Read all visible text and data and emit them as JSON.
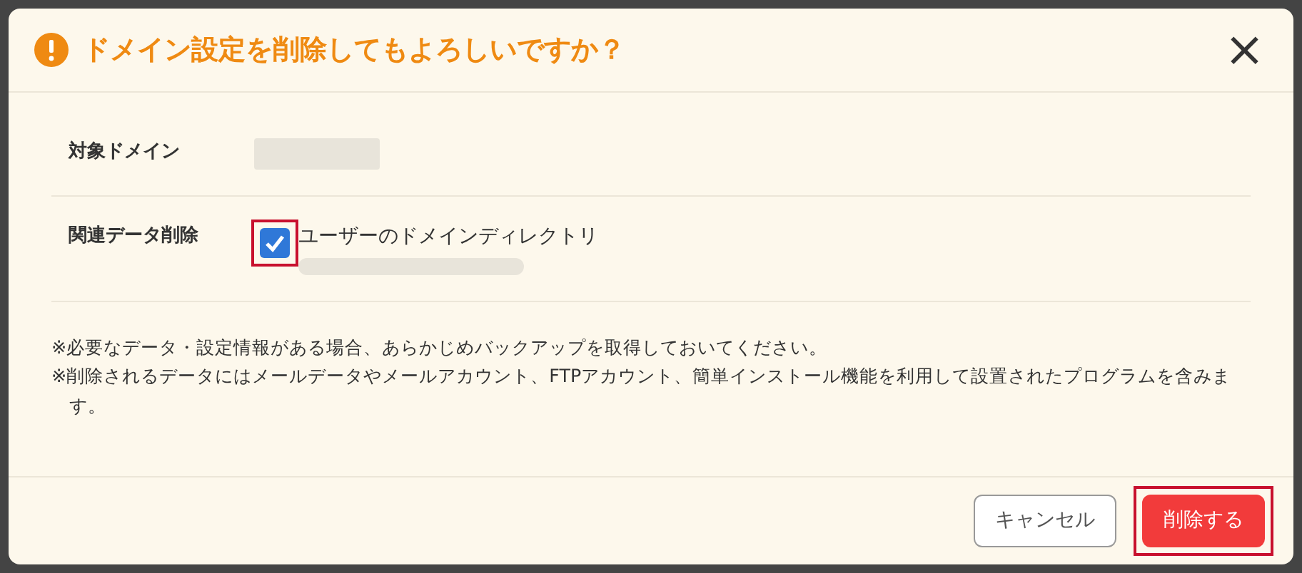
{
  "dialog": {
    "title": "ドメイン設定を削除してもよろしいですか？",
    "close": "×"
  },
  "fields": [
    {
      "kind": "redacted",
      "label": "対象ドメイン"
    },
    {
      "kind": "checkbox",
      "label": "関連データ削除",
      "option": "ユーザーのドメインディレクトリ",
      "checked": true,
      "highlighted": true
    }
  ],
  "notes": [
    "※必要なデータ・設定情報がある場合、あらかじめバックアップを取得しておいてください。",
    "※削除されるデータにはメールデータやメールアカウント、FTPアカウント、簡単インストール機能を利用して設置されたプログラムを含みます。"
  ],
  "buttons": [
    {
      "kind": "secondary",
      "label": "キャンセル",
      "highlighted": false
    },
    {
      "kind": "danger",
      "label": "削除する",
      "highlighted": true
    }
  ]
}
